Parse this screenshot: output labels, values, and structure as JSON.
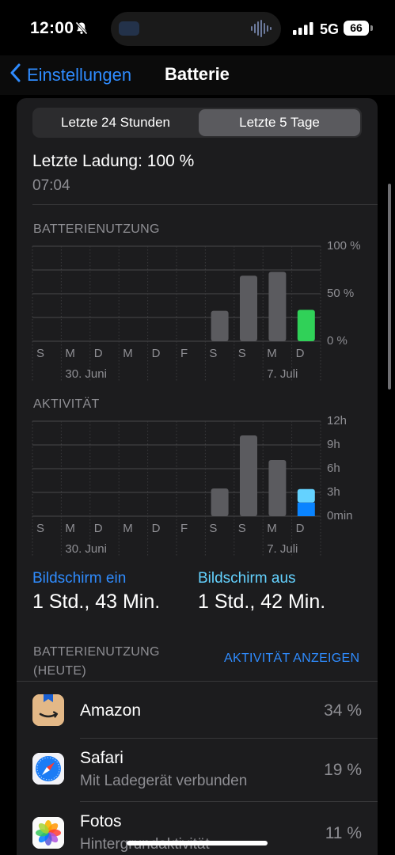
{
  "status_bar": {
    "time": "12:00",
    "network": "5G",
    "battery": "66"
  },
  "nav": {
    "back_label": "Einstellungen",
    "title": "Batterie"
  },
  "segments": [
    {
      "label": "Letzte 24 Stunden",
      "selected": false
    },
    {
      "label": "Letzte 5 Tage",
      "selected": true
    }
  ],
  "last_charge": {
    "label": "Letzte Ladung: 100 %",
    "time": "07:04"
  },
  "battery_chart": {
    "title": "BATTERIENUTZUNG",
    "y_labels": [
      "100 %",
      "50 %",
      "0 %"
    ],
    "days": [
      "S",
      "M",
      "D",
      "M",
      "D",
      "F",
      "S",
      "S",
      "M",
      "D"
    ],
    "date_labels": [
      "30. Juni",
      "7. Juli"
    ]
  },
  "activity_chart": {
    "title": "AKTIVITÄT",
    "y_labels": [
      "12h",
      "9h",
      "6h",
      "3h",
      "0min"
    ],
    "days": [
      "S",
      "M",
      "D",
      "M",
      "D",
      "F",
      "S",
      "S",
      "M",
      "D"
    ],
    "date_labels": [
      "30. Juni",
      "7. Juli"
    ]
  },
  "chart_data": [
    {
      "type": "bar",
      "title": "BATTERIENUTZUNG",
      "categories": [
        "S",
        "M",
        "D",
        "M",
        "D",
        "F",
        "S",
        "S",
        "M",
        "D"
      ],
      "values": [
        0,
        0,
        0,
        0,
        0,
        0,
        32,
        69,
        73,
        33
      ],
      "unit": "%",
      "ylim": [
        0,
        100
      ],
      "colors": {
        "past": "#5b5b5f",
        "today": "#30d158"
      }
    },
    {
      "type": "bar",
      "title": "AKTIVITÄT",
      "categories": [
        "S",
        "M",
        "D",
        "M",
        "D",
        "F",
        "S",
        "S",
        "M",
        "D"
      ],
      "series": [
        {
          "name": "Bildschirm ein",
          "values": [
            0,
            0,
            0,
            0,
            0,
            0,
            0,
            0,
            0,
            1.72
          ],
          "color": "#0a84ff"
        },
        {
          "name": "Bildschirm aus",
          "values": [
            0,
            0,
            0,
            0,
            0,
            0,
            3.5,
            10.2,
            7.1,
            1.7
          ],
          "color": "#64d2ff"
        }
      ],
      "ylim": [
        0,
        12
      ],
      "past_color": "#5b5b5f"
    }
  ],
  "screen": {
    "on_label": "Bildschirm ein",
    "on_value": "1 Std., 43 Min.",
    "off_label": "Bildschirm aus",
    "off_value": "1 Std., 42 Min."
  },
  "usage_header": {
    "line1": "BATTERIENUTZUNG",
    "line2": "(HEUTE)",
    "action": "AKTIVITÄT ANZEIGEN"
  },
  "apps": [
    {
      "name": "Amazon",
      "subtitle": "",
      "percent": "34 %",
      "icon": "amazon-icon"
    },
    {
      "name": "Safari",
      "subtitle": "Mit Ladegerät verbunden",
      "percent": "19 %",
      "icon": "safari-icon"
    },
    {
      "name": "Fotos",
      "subtitle": "Hintergrundaktivität",
      "percent": "11 %",
      "icon": "photos-icon"
    }
  ],
  "colors": {
    "accent": "#2f8cff",
    "screen_off": "#64d2ff"
  }
}
